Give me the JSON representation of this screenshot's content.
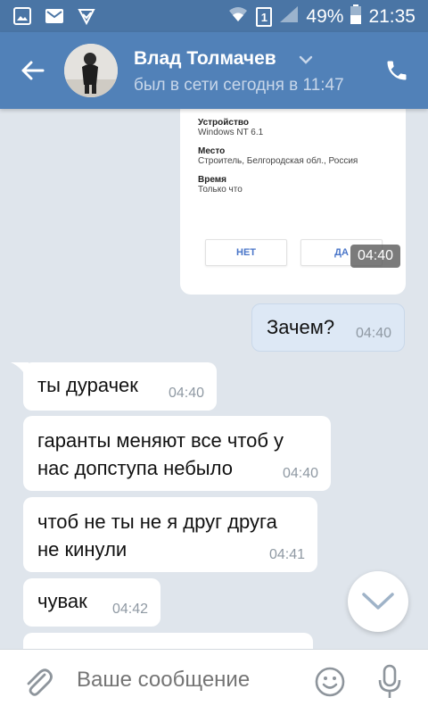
{
  "status_bar": {
    "battery_percent": "49%",
    "time": "21:35",
    "sim": "1"
  },
  "header": {
    "contact_name": "Влад Толмачев",
    "contact_status": "был в сети сегодня в 11:47"
  },
  "screenshot_card": {
    "device_label": "Устройство",
    "device_value": "Windows NT 6.1",
    "place_label": "Место",
    "place_value": "Строитель, Белгородская обл., Россия",
    "time_label": "Время",
    "time_value": "Только что",
    "no_button": "НЕТ",
    "yes_button": "ДА",
    "timestamp": "04:40"
  },
  "messages": [
    {
      "text": "Зачем?",
      "time": "04:40",
      "direction": "out"
    },
    {
      "text": "ты дурачек",
      "time": "04:40",
      "direction": "in"
    },
    {
      "text": "гаранты меняют все чтоб у нас допступа небыло",
      "time": "04:40",
      "direction": "in"
    },
    {
      "text": "чтоб не ты не я друг друга не кинули",
      "time": "04:41",
      "direction": "in"
    },
    {
      "text": "чувак",
      "time": "04:42",
      "direction": "in"
    }
  ],
  "composer": {
    "placeholder": "Ваше сообщение"
  },
  "colors": {
    "header": "#5181b8",
    "status_bar": "#4a75a5",
    "background": "#dfe5ec",
    "outgoing_bubble": "#dde8f5"
  }
}
